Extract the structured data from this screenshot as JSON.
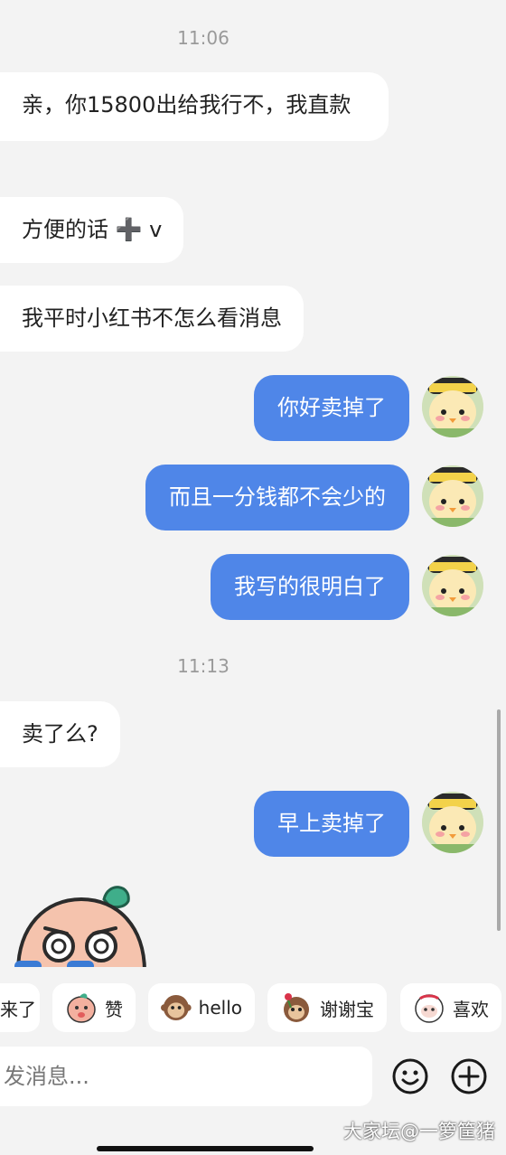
{
  "chat": {
    "timestamps": [
      "11:06",
      "11:13"
    ],
    "messages": [
      {
        "side": "in",
        "text": "亲，你15800出给我行不，我直款"
      },
      {
        "side": "in",
        "text": "方便的话 ➕ v"
      },
      {
        "side": "in",
        "text": "我平时小红书不怎么看消息"
      },
      {
        "side": "out",
        "text": "你好卖掉了"
      },
      {
        "side": "out",
        "text": "而且一分钱都不会少的"
      },
      {
        "side": "out",
        "text": "我写的很明白了"
      },
      {
        "side": "in",
        "text": "卖了么?"
      },
      {
        "side": "out",
        "text": "早上卖掉了"
      }
    ]
  },
  "quick_replies": [
    "来了",
    "赞",
    "hello",
    "谢谢宝",
    "喜欢"
  ],
  "composer": {
    "placeholder": "发消息...",
    "emoji_icon": "smiley-icon",
    "plus_icon": "plus-circle-icon"
  },
  "watermark": "大家坛@一箩筐猪",
  "colors": {
    "background": "#f3f3f3",
    "outgoing_bubble": "#4f86e8",
    "incoming_bubble": "#ffffff"
  }
}
